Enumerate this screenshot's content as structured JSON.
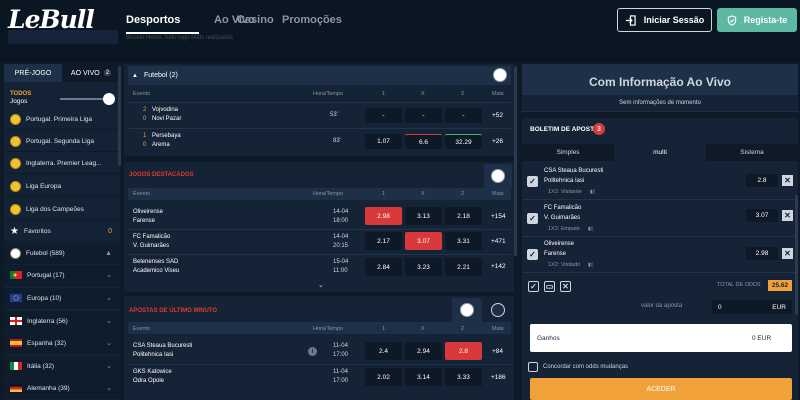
{
  "header": {
    "logo_text_le": "Le",
    "logo_text_bull": "Bull",
    "nav": [
      "Desportos",
      "Ao Vivo",
      "Casino",
      "Promoções"
    ],
    "breadcrumb": "Bookie Home   Todo logo   Mais realizadas",
    "login_label": "Iniciar Sessão",
    "register_label": "Regista-te"
  },
  "sidebar": {
    "tab_prematch": "PRÉ-JOGO",
    "tab_live": "AO VIVO",
    "tab_live_count": "2",
    "todos_label": "TODOS",
    "jogos_label": "Jogos",
    "items": [
      {
        "label": "Portugal. Primeira Liga",
        "icon": "soccer-ball-icon"
      },
      {
        "label": "Portugal. Segunda Liga",
        "icon": "soccer-ball-icon"
      },
      {
        "label": "Inglaterra. Premier Leag...",
        "icon": "soccer-ball-icon"
      },
      {
        "label": "Liga Europa",
        "icon": "soccer-ball-icon"
      },
      {
        "label": "Liga dos Campeões",
        "icon": "soccer-ball-icon"
      }
    ],
    "favoritos_label": "Favoritos",
    "favoritos_count": "0",
    "futebol_label": "Futebol (589)",
    "countries": [
      {
        "label": "Portugal (17)",
        "icon": "portugal-flag-icon"
      },
      {
        "label": "Europa (10)",
        "icon": "europe-flag-icon"
      },
      {
        "label": "Inglaterra (56)",
        "icon": "england-flag-icon"
      },
      {
        "label": "Espanha (32)",
        "icon": "spain-flag-icon"
      },
      {
        "label": "Itália (32)",
        "icon": "italy-flag-icon"
      },
      {
        "label": "Alemanha (39)",
        "icon": "germany-flag-icon"
      }
    ]
  },
  "live": {
    "header": "Futebol",
    "count": "(2)",
    "columns": {
      "event": "Evento",
      "time": "Hora/Tempo",
      "c1": "1",
      "cx": "X",
      "c2": "2",
      "more": "Mais"
    },
    "matches": [
      {
        "s1": "2",
        "s2": "0",
        "t1": "Vojvodina",
        "t2": "Novi Pazar",
        "time": "53'",
        "o1": "-",
        "ox": "-",
        "o2": "-",
        "more": "+52"
      },
      {
        "s1": "1",
        "s2": "0",
        "t1": "Persebaya",
        "t2": "Arema",
        "time": "83'",
        "o1": "1.07",
        "ox": "6.6",
        "o2": "32.29",
        "more": "+26"
      }
    ]
  },
  "featured": {
    "header": "JOGOS DESTACADOS",
    "columns": {
      "event": "Evento",
      "time": "Hora/Tempo",
      "c1": "1",
      "cx": "X",
      "c2": "2",
      "more": "Mais"
    },
    "matches": [
      {
        "t1": "Oliveirense",
        "t2": "Farense",
        "date": "14-04",
        "hour": "18:00",
        "o1": "2.98",
        "ox": "3.13",
        "o2": "2.18",
        "more": "+154"
      },
      {
        "t1": "FC Famalicão",
        "t2": "V. Guimarães",
        "date": "14-04",
        "hour": "20:15",
        "o1": "2.17",
        "ox": "3.07",
        "o2": "3.31",
        "more": "+471"
      },
      {
        "t1": "Belenenses SAD",
        "t2": "Academico Viseu",
        "date": "15-04",
        "hour": "11:00",
        "o1": "2.84",
        "ox": "3.23",
        "o2": "2.21",
        "more": "+142"
      }
    ]
  },
  "lastminute": {
    "header": "APOSTAS DE ÚLTIMO MINUTO",
    "columns": {
      "event": "Evento",
      "time": "Hora/Tempo",
      "c1": "1",
      "cx": "X",
      "c2": "2",
      "more": "Mais"
    },
    "matches": [
      {
        "t1": "CSA Steaua Bucuresti",
        "t2": "Politehnica Iasi",
        "date": "11-04",
        "hour": "17:00",
        "o1": "2.4",
        "ox": "2.94",
        "o2": "2.8",
        "more": "+84"
      },
      {
        "t1": "GKS Katowice",
        "t2": "Odra Opole",
        "date": "11-04",
        "hour": "17:00",
        "o1": "2.02",
        "ox": "3.14",
        "o2": "3.33",
        "more": "+186"
      }
    ]
  },
  "info": {
    "title": "Com Informação Ao Vivo",
    "subtitle": "Sem informações de momento"
  },
  "betslip": {
    "title": "BOLETIM DE APOSTAS",
    "count": "3",
    "tabs": [
      "Simples",
      "multi",
      "Sistema"
    ],
    "bets": [
      {
        "t1": "CSA Steaua Bucuresti",
        "t2": "Politehnica Iasi",
        "market": "1X2: Visitante",
        "odd": "2.8"
      },
      {
        "t1": "FC Famalicão",
        "t2": "V. Guimarães",
        "market": "1X2: Empate",
        "odd": "3.07"
      },
      {
        "t1": "Oliveirense",
        "t2": "Farense",
        "market": "1X2: Visitado",
        "odd": "2.98"
      }
    ],
    "total_label": "TOTAL DE ODDS",
    "total_value": "25.62",
    "stake_label": "valor da aposta",
    "stake_value": "0",
    "currency": "EUR",
    "win_label": "Ganhos",
    "win_value": "0 EUR",
    "accept_label": "Concordar com odds mudanças",
    "submit_label": "ACEDER"
  },
  "colors": {
    "accent": "#5cb8a3",
    "selected": "#d9393a",
    "orange": "#f0a13a",
    "yellow_ball": "#f2c230"
  }
}
